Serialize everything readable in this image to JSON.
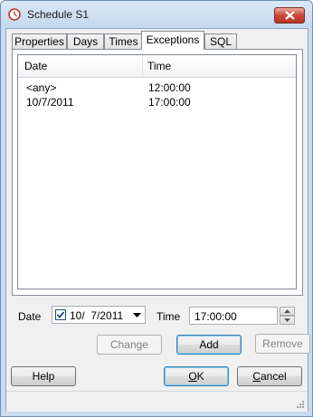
{
  "window": {
    "title": "Schedule S1"
  },
  "tabs": [
    {
      "label": "Properties",
      "active": false
    },
    {
      "label": "Days",
      "active": false
    },
    {
      "label": "Times",
      "active": false
    },
    {
      "label": "Exceptions",
      "active": true
    },
    {
      "label": "SQL",
      "active": false
    }
  ],
  "list": {
    "columns": [
      "Date",
      "Time"
    ],
    "rows": [
      {
        "date": "<any>",
        "time": "12:00:00"
      },
      {
        "date": "10/7/2011",
        "time": "17:00:00"
      }
    ]
  },
  "form": {
    "date_label": "Date",
    "date_value": "10/  7/2011",
    "date_checked": true,
    "time_label": "Time",
    "time_value": "17:00:00"
  },
  "actions": {
    "change": "Change",
    "add": "Add",
    "remove": "Remove"
  },
  "footer": {
    "help": "Help",
    "ok": "OK",
    "cancel": "Cancel"
  },
  "colors": {
    "title_bar": "#c4d8ee",
    "close_button": "#c9483a",
    "default_button_border": "#3c7fb1"
  }
}
